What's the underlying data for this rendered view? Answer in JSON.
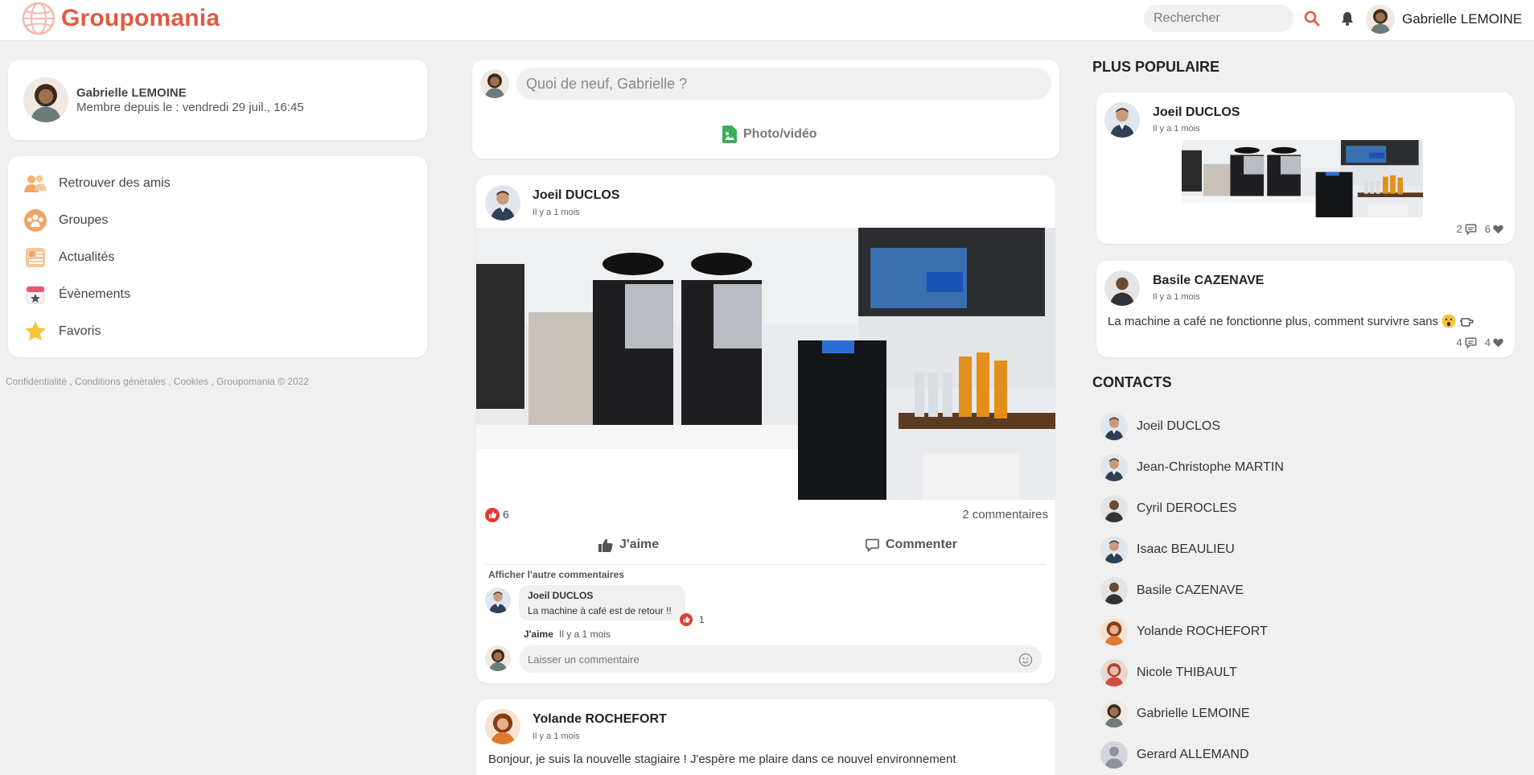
{
  "header": {
    "logo_text": "Groupomania",
    "search_placeholder": "Rechercher",
    "user_name": "Gabrielle LEMOINE"
  },
  "colors": {
    "brand": "#e05a3f",
    "green": "#3bae5a",
    "like_red": "#e03b2f"
  },
  "profile": {
    "name": "Gabrielle LEMOINE",
    "member_since": "Membre depuis le : vendredi 29 juil., 16:45"
  },
  "nav": {
    "items": [
      {
        "label": "Retrouver des amis",
        "icon": "friends-icon"
      },
      {
        "label": "Groupes",
        "icon": "groups-icon"
      },
      {
        "label": "Actualités",
        "icon": "news-icon"
      },
      {
        "label": "Évènements",
        "icon": "events-icon"
      },
      {
        "label": "Favoris",
        "icon": "star-icon"
      }
    ]
  },
  "footer": {
    "links": "Confidentialité , Conditions générales , Cookies , Groupomania © 2022"
  },
  "composer": {
    "placeholder": "Quoi de neuf, Gabrielle ?",
    "photo_label": "Photo/vidéo"
  },
  "feed": {
    "post1": {
      "author": "Joeil DUCLOS",
      "time": "Il y a 1 mois",
      "likes": "6",
      "comments": "2 commentaires",
      "like_label": "J'aime",
      "comment_label": "Commenter",
      "other_comments": "Afficher l'autre commentaires",
      "comment": {
        "author": "Joeil DUCLOS",
        "text": "La machine à café est de retour !!",
        "likes": "1",
        "like_link": "J'aime",
        "time": "Il y a 1 mois"
      },
      "new_comment_placeholder": "Laisser un commentaire"
    },
    "post2": {
      "author": "Yolande ROCHEFORT",
      "time": "Il y a 1 mois",
      "text": "Bonjour, je suis la nouvelle stagiaire ! J'espère me plaire dans ce nouvel environnement"
    }
  },
  "popular": {
    "title": "PLUS POPULAIRE",
    "items": [
      {
        "author": "Joeil DUCLOS",
        "time": "Il y a 1 mois",
        "comments": "2",
        "likes": "6"
      },
      {
        "author": "Basile CAZENAVE",
        "time": "Il y a 1 mois",
        "text": "La machine a café ne fonctionne plus, comment survivre sans",
        "comments": "4",
        "likes": "4"
      }
    ]
  },
  "contacts": {
    "title": "CONTACTS",
    "items": [
      "Joeil DUCLOS",
      "Jean-Christophe MARTIN",
      "Cyril DEROCLES",
      "Isaac BEAULIEU",
      "Basile CAZENAVE",
      "Yolande ROCHEFORT",
      "Nicole THIBAULT",
      "Gabrielle LEMOINE",
      "Gerard ALLEMAND"
    ]
  }
}
